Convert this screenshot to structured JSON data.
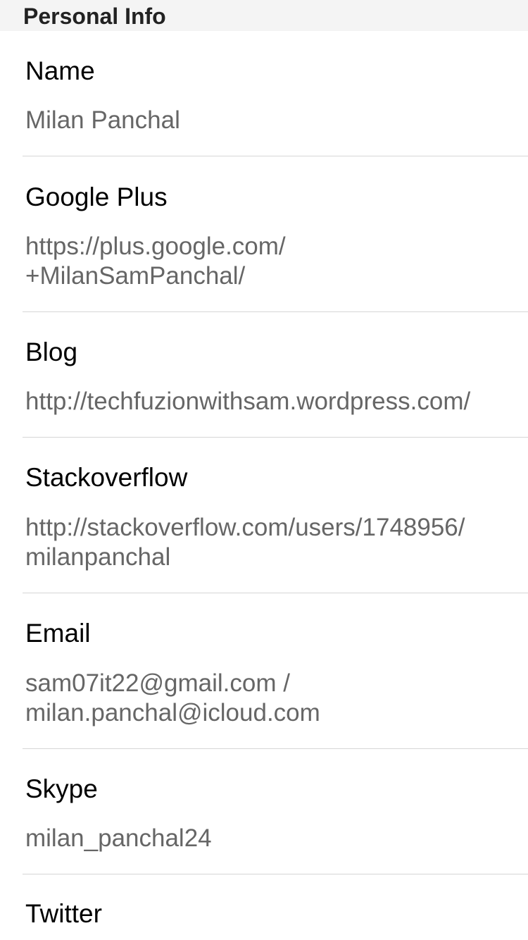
{
  "section": {
    "title": "Personal Info"
  },
  "fields": [
    {
      "label": "Name",
      "value": "Milan Panchal"
    },
    {
      "label": "Google Plus",
      "value": "https://plus.google.com/\n+MilanSamPanchal/"
    },
    {
      "label": "Blog",
      "value": "http://techfuzionwithsam.wordpress.com/"
    },
    {
      "label": "Stackoverflow",
      "value": "http://stackoverflow.com/users/1748956/\nmilanpanchal"
    },
    {
      "label": "Email",
      "value": "sam07it22@gmail.com /\nmilan.panchal@icloud.com"
    },
    {
      "label": "Skype",
      "value": "milan_panchal24"
    },
    {
      "label": "Twitter",
      "value": ""
    }
  ]
}
